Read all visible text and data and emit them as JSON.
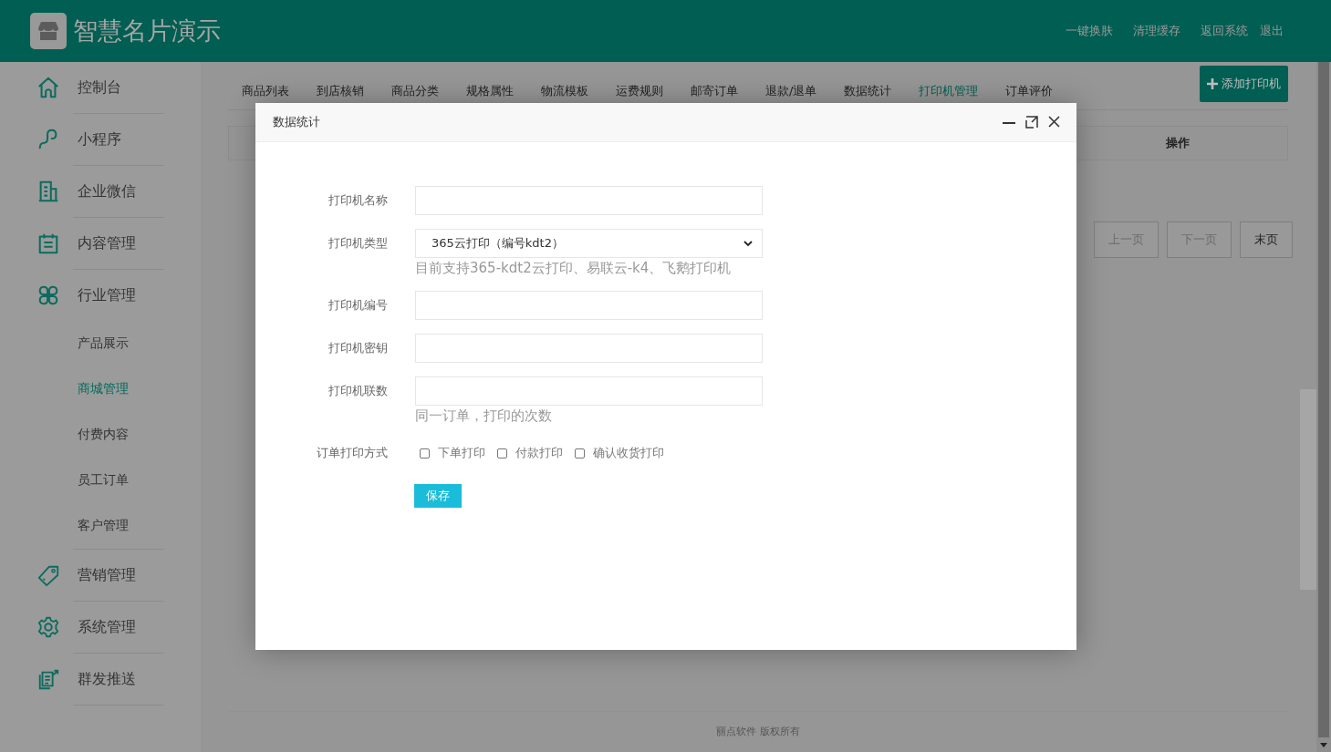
{
  "header": {
    "logo_text": "智慧名片演示",
    "links": [
      "一键换肤",
      "清理缓存",
      "返回系统",
      "退出"
    ]
  },
  "sidebar": {
    "items": [
      {
        "label": "控制台",
        "kind": "main",
        "selected": false
      },
      {
        "label": "小程序",
        "kind": "main",
        "selected": false
      },
      {
        "label": "企业微信",
        "kind": "main",
        "selected": false
      },
      {
        "label": "内容管理",
        "kind": "main",
        "selected": false
      },
      {
        "label": "行业管理",
        "kind": "main",
        "selected": false
      },
      {
        "label": "产品展示",
        "kind": "sub",
        "selected": false
      },
      {
        "label": "商城管理",
        "kind": "sub",
        "selected": true
      },
      {
        "label": "付费内容",
        "kind": "sub",
        "selected": false
      },
      {
        "label": "员工订单",
        "kind": "sub",
        "selected": false
      },
      {
        "label": "客户管理",
        "kind": "sub",
        "selected": false
      },
      {
        "label": "营销管理",
        "kind": "main",
        "selected": false
      },
      {
        "label": "系统管理",
        "kind": "main",
        "selected": false
      },
      {
        "label": "群发推送",
        "kind": "main",
        "selected": false
      }
    ]
  },
  "tabs": [
    {
      "label": "商品列表",
      "selected": false
    },
    {
      "label": "到店核销",
      "selected": false
    },
    {
      "label": "商品分类",
      "selected": false
    },
    {
      "label": "规格属性",
      "selected": false
    },
    {
      "label": "物流模板",
      "selected": false
    },
    {
      "label": "运费规则",
      "selected": false
    },
    {
      "label": "邮寄订单",
      "selected": false
    },
    {
      "label": "退款/退单",
      "selected": false
    },
    {
      "label": "数据统计",
      "selected": false
    },
    {
      "label": "打印机管理",
      "selected": true
    },
    {
      "label": "订单评价",
      "selected": false
    }
  ],
  "add_button": "添加打印机",
  "table": {
    "columns": [
      "操作"
    ]
  },
  "pagination": [
    "上一页",
    "下一页",
    "末页"
  ],
  "footer": "丽点软件 版权所有",
  "modal": {
    "title": "数据统计",
    "fields": [
      {
        "label": "打印机名称",
        "kind": "text"
      },
      {
        "label": "打印机类型",
        "kind": "select",
        "value": "365云打印（编号kdt2）",
        "hint": "目前支持365-kdt2云打印、易联云-k4、飞鹅打印机"
      },
      {
        "label": "打印机编号",
        "kind": "text"
      },
      {
        "label": "打印机密钥",
        "kind": "text"
      },
      {
        "label": "打印机联数",
        "kind": "text",
        "hint": "同一订单，打印的次数"
      }
    ],
    "print_mode": {
      "label": "订单打印方式",
      "options": [
        {
          "label": "下单打印",
          "checked": false
        },
        {
          "label": "付款打印",
          "checked": false
        },
        {
          "label": "确认收货打印",
          "checked": false
        }
      ]
    },
    "save_button": "保存"
  }
}
